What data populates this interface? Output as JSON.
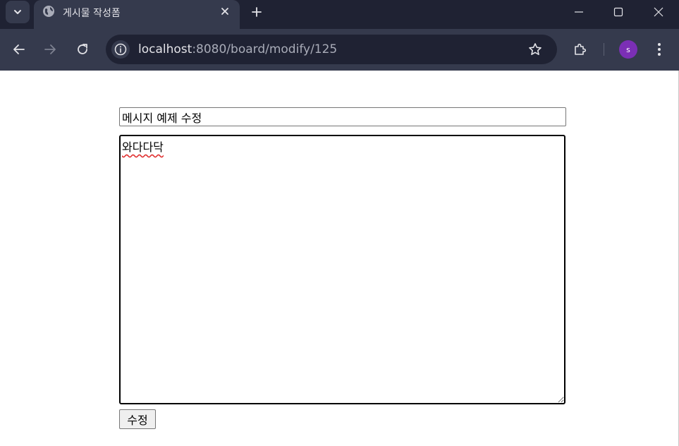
{
  "browser": {
    "tab": {
      "title": "게시물 작성폼"
    },
    "omnibox": {
      "host": "localhost",
      "path": ":8080/board/modify/125"
    },
    "profile": {
      "initial": "s"
    }
  },
  "form": {
    "title_value": "메시지 예제 수정",
    "content_value": "와다다닥",
    "submit_label": "수정"
  }
}
